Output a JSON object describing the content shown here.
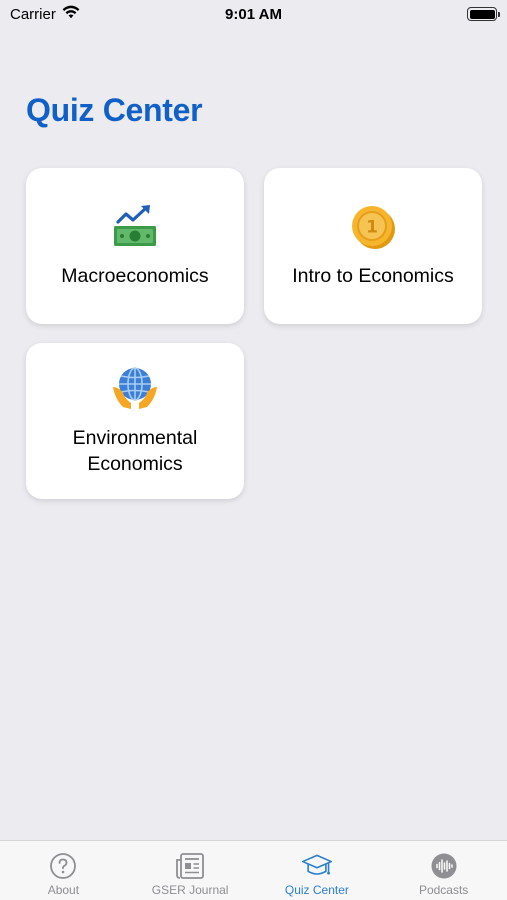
{
  "status_bar": {
    "carrier": "Carrier",
    "time": "9:01 AM",
    "icons": [
      "wifi-icon",
      "battery-icon"
    ]
  },
  "page": {
    "title": "Quiz Center",
    "title_color": "#1060c8"
  },
  "cards": [
    {
      "label": "Macroeconomics",
      "icon": "money-chart-icon"
    },
    {
      "label": "Intro to Economics",
      "icon": "coin-icon"
    },
    {
      "label": "Environmental Economics",
      "icon": "globe-hands-icon"
    }
  ],
  "tab_bar": {
    "active_color": "#2a7fcf",
    "inactive_color": "#8e8e93",
    "items": [
      {
        "label": "About",
        "icon": "question-circle-icon",
        "active": false
      },
      {
        "label": "GSER Journal",
        "icon": "newspaper-icon",
        "active": false
      },
      {
        "label": "Quiz Center",
        "icon": "graduation-cap-icon",
        "active": true
      },
      {
        "label": "Podcasts",
        "icon": "waveform-icon",
        "active": false
      }
    ]
  }
}
